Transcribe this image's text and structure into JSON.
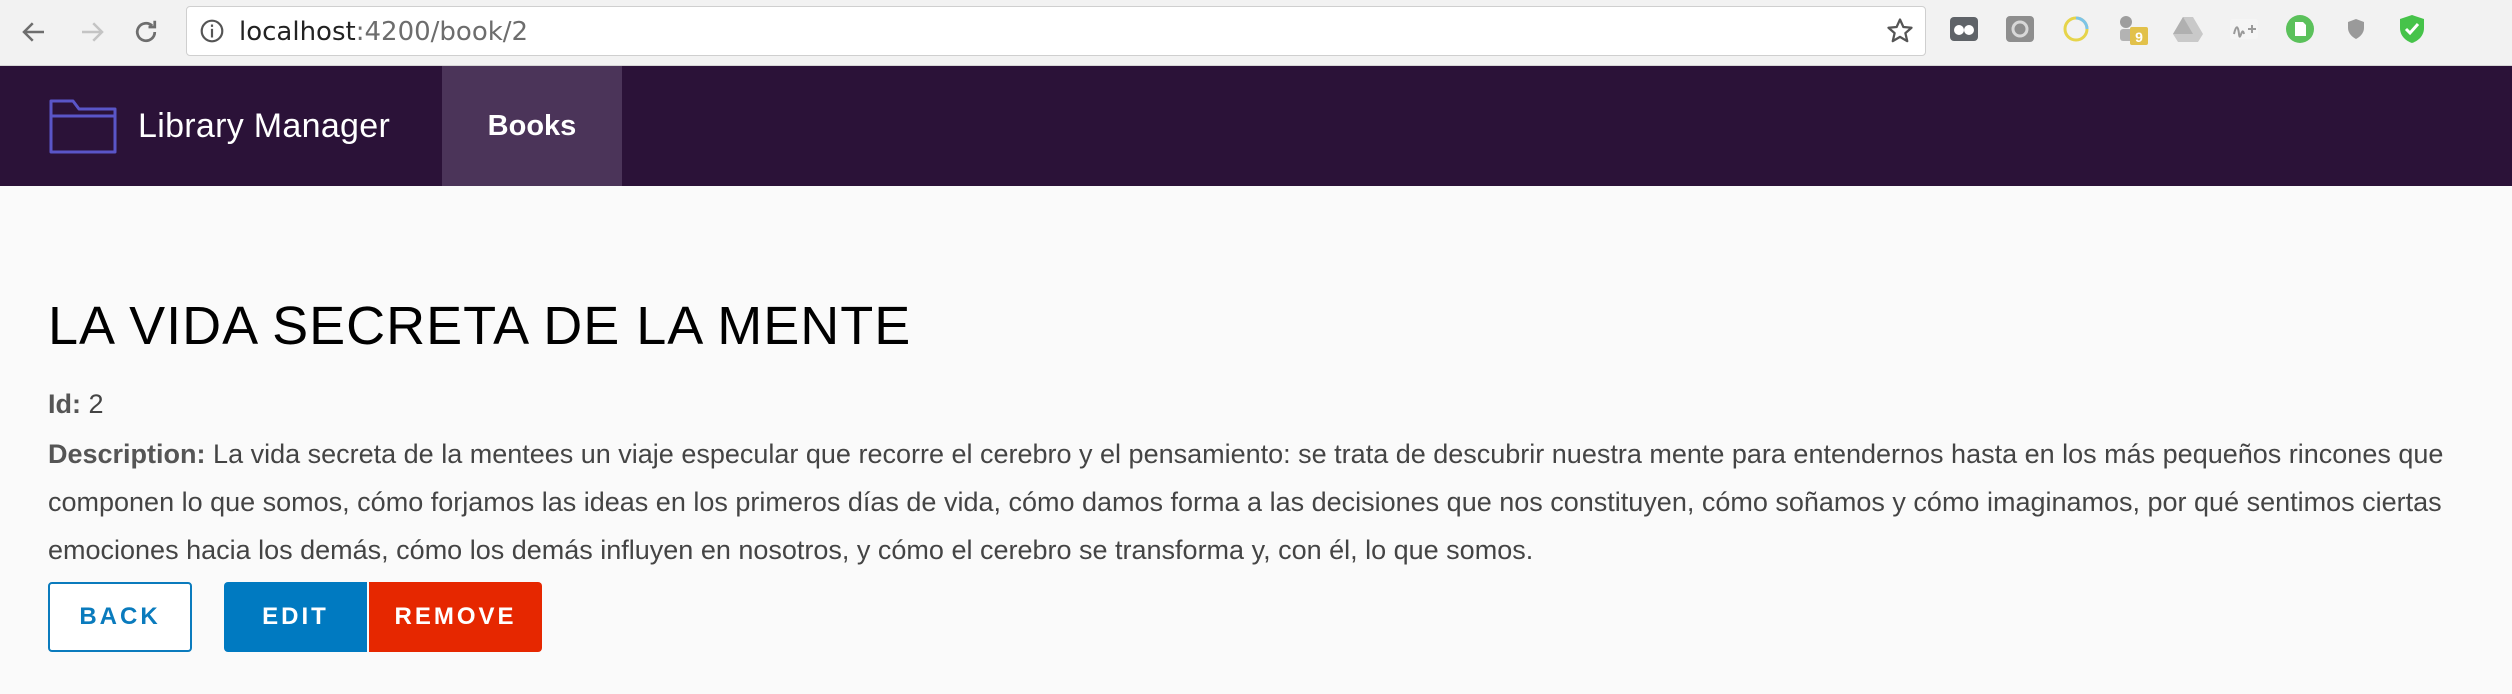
{
  "browser": {
    "url_host": "localhost",
    "url_path": ":4200/book/2",
    "extensions": [
      "tab-manager-icon",
      "screen-capture-icon",
      "loading-ring-icon",
      "badge-extension-icon",
      "drive-icon",
      "movistar-icon",
      "evernote-icon",
      "shield-icon",
      "check-shield-icon"
    ],
    "extension_badge": "9"
  },
  "header": {
    "brand_title": "Library Manager",
    "nav_books": "Books",
    "colors": {
      "background": "#2b1238",
      "active_tab": "#4b3459",
      "logo": "#5a55c8"
    }
  },
  "book": {
    "title": "LA VIDA SECRETA DE LA MENTE",
    "id_label": "Id:",
    "id_value": "2",
    "description_label": "Description:",
    "description": "La vida secreta de la mentees un viaje especular que recorre el cerebro y el pensamiento: se trata de descubrir nuestra mente para entendernos hasta en los más pequeños rincones que componen lo que somos, cómo forjamos las ideas en los primeros días de vida, cómo damos forma a las decisiones que nos constituyen, cómo soñamos y cómo imaginamos, por qué sentimos ciertas emociones hacia los demás, cómo los demás influyen en nosotros, y cómo el cerebro se transforma y, con él, lo que somos."
  },
  "actions": {
    "back": "BACK",
    "edit": "EDIT",
    "remove": "REMOVE",
    "colors": {
      "primary": "#007ac1",
      "danger": "#e62700"
    }
  }
}
